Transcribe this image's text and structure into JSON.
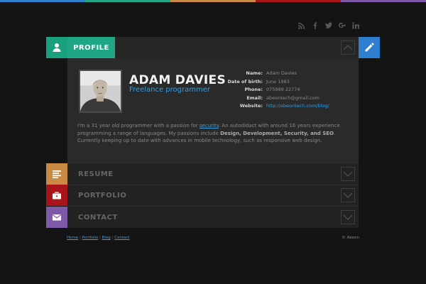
{
  "colors": {
    "topbar": [
      "#2e7fcf",
      "#1fa785",
      "#c88a45",
      "#a8141a",
      "#7d59a8"
    ],
    "profile_accent": "#1fa785",
    "resume_accent": "#c88a45",
    "portfolio_accent": "#a8141a",
    "contact_accent": "#7d59a8",
    "edit_accent": "#2e7fcf",
    "link": "#3d9bd8"
  },
  "social": {
    "icons": [
      "rss-icon",
      "facebook-icon",
      "twitter-icon",
      "google-plus-icon",
      "linkedin-icon"
    ]
  },
  "sections": {
    "profile": {
      "label": "PROFILE",
      "icon": "user-icon"
    },
    "resume": {
      "label": "RESUME",
      "icon": "list-icon"
    },
    "portfolio": {
      "label": "PORTFOLIO",
      "icon": "briefcase-icon"
    },
    "contact": {
      "label": "CONTACT",
      "icon": "envelope-icon"
    }
  },
  "profile": {
    "name": "ADAM DAVIES",
    "title": "Freelance programmer",
    "info": [
      {
        "label": "Name:",
        "value": "Adam Davies"
      },
      {
        "label": "Date of birth:",
        "value": "June 1983"
      },
      {
        "label": "Phone:",
        "value": "075999 22774"
      },
      {
        "label": "Email:",
        "value": "abeontech@gmail.com"
      },
      {
        "label": "Website:",
        "value": "http://abeontech.com/blog/"
      }
    ],
    "bio": {
      "part1": "I'm a 31 year old programmer with a passion for ",
      "link": "security",
      "part2": ". An autodidact with around 16 years experience programming a range of languages. My passions include ",
      "bold": "Design, Development, Security, and SEO",
      "part3": ". Currently keeping up to date with advances in mobile technology, such as responsive web design."
    }
  },
  "footer": {
    "links": [
      "Home",
      "Portfolio",
      "Blog",
      "Contact"
    ],
    "separator": " | ",
    "copyright": "© Abeon"
  }
}
